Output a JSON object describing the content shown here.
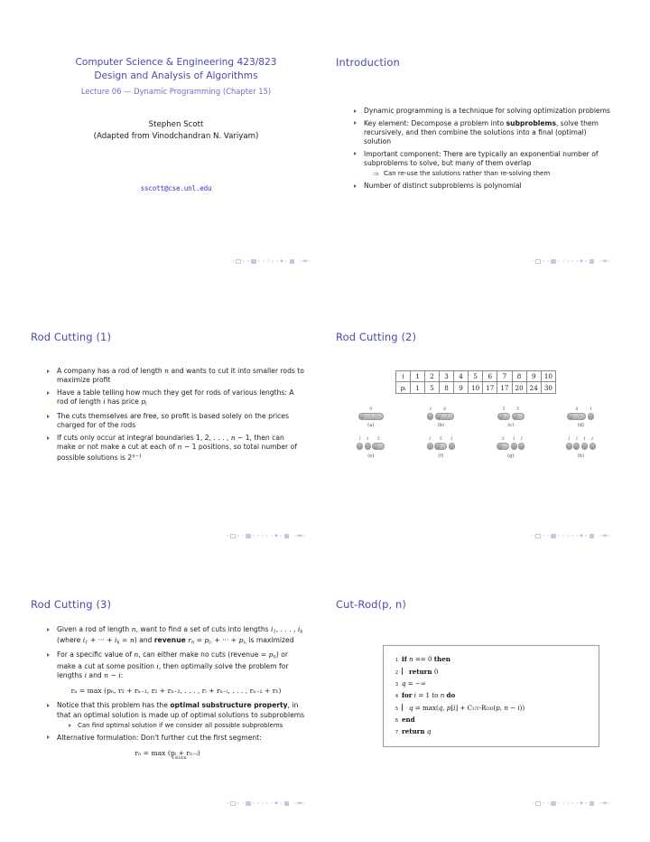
{
  "document": {
    "type": "lecture-slides-handout",
    "accent_color": "#4a4ab0",
    "bullet_color": "#5a5ab5",
    "text_color": "#1c1c1c"
  },
  "title_slide": {
    "course_line1": "Computer Science & Engineering 423/823",
    "course_line2": "Design and Analysis of Algorithms",
    "lecture_line": "Lecture 06 — Dynamic Programming (Chapter 15)",
    "author": "Stephen Scott",
    "author_sub": "(Adapted from Vinodchandran N. Variyam)",
    "email": "sscott@cse.unl.edu"
  },
  "intro_slide": {
    "title": "Introduction",
    "bullets": [
      "Dynamic programming is a technique for solving optimization problems",
      "Key element: Decompose a problem into <b class=\"bold\">subproblems</b>, solve them recursively, and then combine the solutions into a final (optimal) solution",
      "Important component: There are typically an exponential number of subproblems to solve, but many of them overlap",
      "Number of distinct subproblems is polynomial"
    ],
    "sub_arrow": "Can re-use the solutions rather than re-solving them",
    "sub_arrow_glyph": "⇒"
  },
  "rod_cutting_1": {
    "title": "Rod Cutting (1)",
    "bullets": [
      "A company has a rod of length <span class=\"mathi\">n</span> and wants to cut it into smaller rods to maximize profit",
      "Have a table telling how much they get for rods of various lengths: A rod of length <span class=\"mathi\">i</span> has price <span class=\"mathi\">p<sub class=\"s\">i</sub></span>",
      "The cuts themselves are free, so profit is based solely on the prices charged for of the rods",
      "If cuts only occur at integral boundaries 1, 2, . . . , <span class=\"mathi\">n</span> &minus; 1, then can make or not make a cut at each of <span class=\"mathi\">n</span> &minus; 1 positions, so total number of possible solutions is 2<sup class=\"s\">n&minus;1</sup>"
    ]
  },
  "rod_cutting_2": {
    "title": "Rod Cutting (2)",
    "price_table": {
      "row_headers": [
        "i",
        "pᵢ"
      ],
      "i_values": [
        "1",
        "2",
        "3",
        "4",
        "5",
        "6",
        "7",
        "8",
        "9",
        "10"
      ],
      "p_values": [
        "1",
        "5",
        "8",
        "9",
        "10",
        "17",
        "17",
        "20",
        "24",
        "30"
      ]
    },
    "figures": [
      {
        "caption": "(a)",
        "pieces": [
          {
            "len": 4,
            "label": "9"
          }
        ]
      },
      {
        "caption": "(b)",
        "pieces": [
          {
            "len": 1,
            "label": "1"
          },
          {
            "len": 3,
            "label": "8"
          }
        ]
      },
      {
        "caption": "(c)",
        "pieces": [
          {
            "len": 2,
            "label": "5"
          },
          {
            "len": 2,
            "label": "5"
          }
        ]
      },
      {
        "caption": "(d)",
        "pieces": [
          {
            "len": 3,
            "label": "8"
          },
          {
            "len": 1,
            "label": "1"
          }
        ]
      },
      {
        "caption": "(e)",
        "pieces": [
          {
            "len": 1,
            "label": "1"
          },
          {
            "len": 1,
            "label": "1"
          },
          {
            "len": 2,
            "label": "5"
          }
        ]
      },
      {
        "caption": "(f)",
        "pieces": [
          {
            "len": 1,
            "label": "1"
          },
          {
            "len": 2,
            "label": "5"
          },
          {
            "len": 1,
            "label": "1"
          }
        ]
      },
      {
        "caption": "(g)",
        "pieces": [
          {
            "len": 2,
            "label": "5"
          },
          {
            "len": 1,
            "label": "1"
          },
          {
            "len": 1,
            "label": "1"
          }
        ]
      },
      {
        "caption": "(h)",
        "pieces": [
          {
            "len": 1,
            "label": "1"
          },
          {
            "len": 1,
            "label": "1"
          },
          {
            "len": 1,
            "label": "1"
          },
          {
            "len": 1,
            "label": "1"
          }
        ]
      }
    ]
  },
  "rod_cutting_3": {
    "title": "Rod Cutting (3)",
    "bullets": [
      "Given a rod of length <span class=\"mathi\">n</span>, want to find a set of cuts into lengths <span class=\"mathi\">i<sub class=\"s\">1</sub></span>, . . . , <span class=\"mathi\">i<sub class=\"s\">k</sub></span> (where <span class=\"mathi\">i<sub class=\"s\">1</sub></span> + &middot;&middot;&middot; + <span class=\"mathi\">i<sub class=\"s\">k</sub></span> = <span class=\"mathi\">n</span>) and <b class=\"bold\">revenue</b> <span class=\"mathi\">r<sub class=\"s\">n</sub></span> = <span class=\"mathi\">p<sub class=\"s\">i₁</sub></span> + &middot;&middot;&middot; + <span class=\"mathi\">p<sub class=\"s\">iₖ</sub></span> is maximized",
      "For a specific value of <span class=\"mathi\">n</span>, can either make no cuts (revenue = <span class=\"mathi\">p<sub class=\"s\">n</sub></span>) or make a cut at some position <span class=\"mathi\">i</span>, then optimally solve the problem for lengths <span class=\"mathi\">i</span> and <span class=\"mathi\">n</span> &minus; <span class=\"mathi\">i</span>:",
      "Notice that this problem has the <b class=\"bold\">optimal substructure property</b>, in that an optimal solution is made up of optimal solutions to subproblems",
      "Alternative formulation: Don't further cut the first segment:"
    ],
    "sub_bullet": "Can find optimal solution if we consider all possible subproblems",
    "equation_1": "rₙ = max (pₙ, r₁ + rₙ₋₁, r₂ + rₙ₋₂, . . . , rᵢ + rₙ₋ᵢ, . . . , rₙ₋₁ + r₁)",
    "equation_2": "rₙ = max (pᵢ + rₙ₋ᵢ)",
    "equation_2_sub": "1≤i≤n"
  },
  "cut_rod": {
    "title": "Cut-Rod(p, n)",
    "lines": [
      {
        "no": "1",
        "indent": 0,
        "text": "<span class=\"kw\">if</span> <span class=\"mathi\">n</span> == 0 <span class=\"kw\">then</span>"
      },
      {
        "no": "2",
        "indent": 1,
        "text": "<span class=\"kw\">return</span> 0"
      },
      {
        "no": "3",
        "indent": 0,
        "text": "<span class=\"mathi\">q</span> = &minus;&infin;"
      },
      {
        "no": "4",
        "indent": 0,
        "text": "<span class=\"kw\">for</span> <span class=\"mathi\">i</span> = 1 <i class=\"it\">to</i> <span class=\"mathi\">n</span> <span class=\"kw\">do</span>"
      },
      {
        "no": "5",
        "indent": 1,
        "text": "<span class=\"mathi\">q</span> = max(<span class=\"mathi\">q</span>, <span class=\"mathi\">p</span>[<span class=\"mathi\">i</span>] + <span class=\"sc\">Cut-Rod</span>(<span class=\"mathi\">p</span>, <span class=\"mathi\">n</span> &minus; <span class=\"mathi\">i</span>))"
      },
      {
        "no": "6",
        "indent": 0,
        "text": "<span class=\"kw\">end</span>"
      },
      {
        "no": "7",
        "indent": 0,
        "text": "<span class=\"kw\">return</span> <span class=\"mathi\">q</span>"
      }
    ]
  },
  "nav": {
    "symbols": [
      "slide-nav-back",
      "slide-nav-forward",
      "frame-nav",
      "subsection-nav",
      "section-nav",
      "presentation-nav",
      "doc-nav"
    ]
  }
}
